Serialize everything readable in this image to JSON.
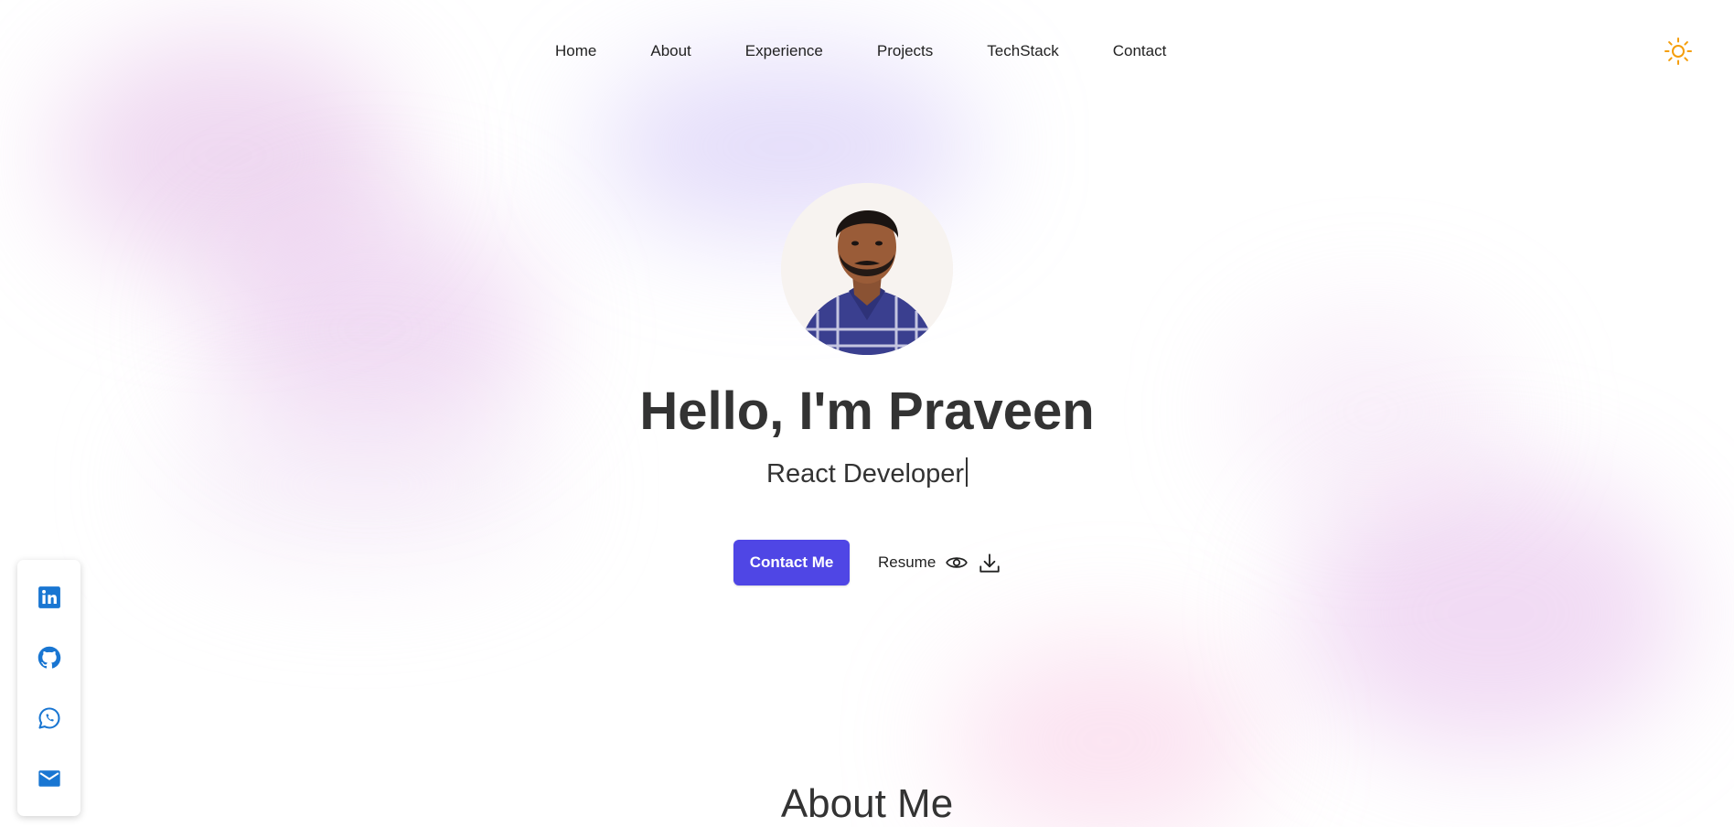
{
  "nav": {
    "links": [
      "Home",
      "About",
      "Experience",
      "Projects",
      "TechStack",
      "Contact"
    ],
    "theme_icon": "sun-icon"
  },
  "hero": {
    "title": "Hello, I'm Praveen",
    "subtitle": "React Developer",
    "contact_button": "Contact Me",
    "resume_label": "Resume",
    "resume_icons": [
      "eye-icon",
      "download-icon"
    ]
  },
  "social": {
    "icons": [
      "linkedin-icon",
      "github-icon",
      "whatsapp-icon",
      "mail-icon"
    ]
  },
  "about": {
    "heading": "About Me"
  },
  "colors": {
    "accent": "#4f46e5",
    "social_icon": "#1976d2",
    "sun": "#f59e0b",
    "text": "#333333"
  }
}
